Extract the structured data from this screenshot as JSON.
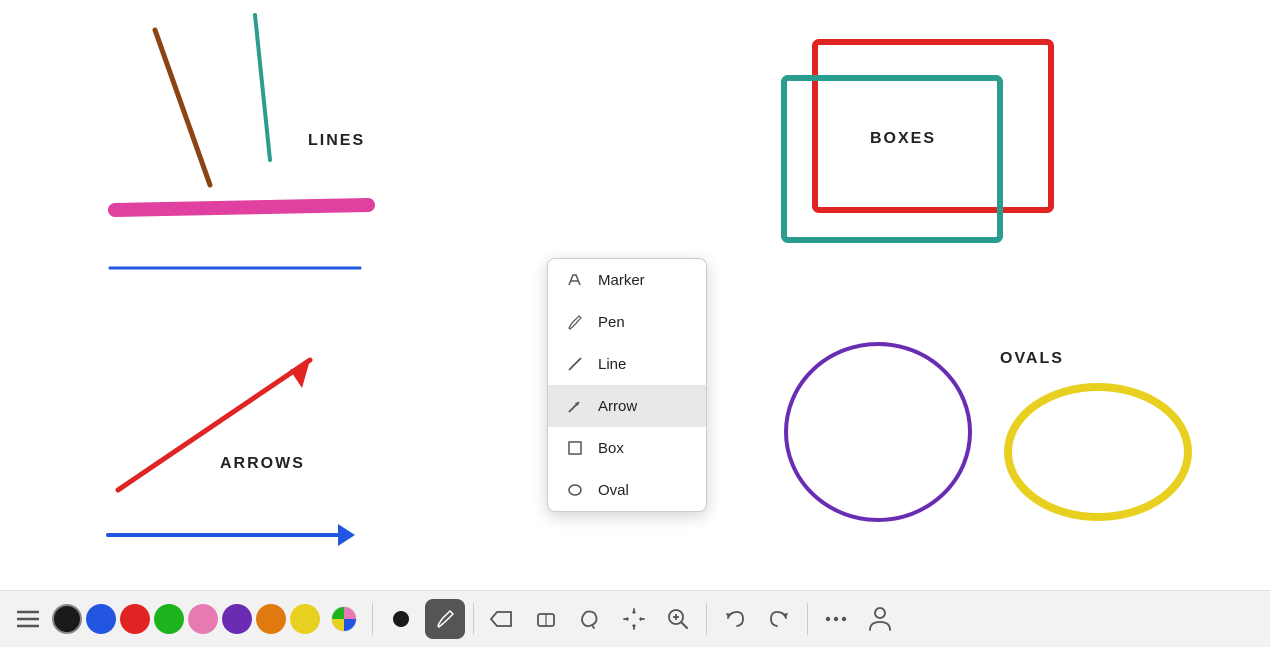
{
  "canvas": {
    "background": "#ffffff"
  },
  "labels": {
    "lines": "LINES",
    "arrows": "ARROWS",
    "boxes": "BOXES",
    "ovals": "OVALS"
  },
  "menu": {
    "items": [
      {
        "id": "marker",
        "label": "Marker",
        "icon": "marker"
      },
      {
        "id": "pen",
        "label": "Pen",
        "icon": "pen"
      },
      {
        "id": "line",
        "label": "Line",
        "icon": "line"
      },
      {
        "id": "arrow",
        "label": "Arrow",
        "icon": "arrow",
        "selected": true
      },
      {
        "id": "box",
        "label": "Box",
        "icon": "box"
      },
      {
        "id": "oval",
        "label": "Oval",
        "icon": "oval"
      }
    ]
  },
  "toolbar": {
    "colors": [
      {
        "id": "black",
        "hex": "#1a1a1a",
        "active": true
      },
      {
        "id": "blue",
        "hex": "#2356e0"
      },
      {
        "id": "red",
        "hex": "#e02323"
      },
      {
        "id": "green",
        "hex": "#1db31d"
      },
      {
        "id": "pink",
        "hex": "#e87ab3"
      },
      {
        "id": "purple",
        "hex": "#6a2cb3"
      },
      {
        "id": "orange",
        "hex": "#e07a10"
      },
      {
        "id": "yellow",
        "hex": "#e8d020"
      },
      {
        "id": "multi",
        "hex": "multi"
      }
    ],
    "tools": [
      {
        "id": "dot",
        "label": "Dot"
      },
      {
        "id": "pen-active",
        "label": "Pen Active",
        "active": true
      },
      {
        "id": "label-tool",
        "label": "Label"
      },
      {
        "id": "eraser",
        "label": "Eraser"
      },
      {
        "id": "lasso",
        "label": "Lasso"
      },
      {
        "id": "move",
        "label": "Move"
      },
      {
        "id": "zoom",
        "label": "Zoom"
      },
      {
        "id": "undo",
        "label": "Undo"
      },
      {
        "id": "redo",
        "label": "Redo"
      },
      {
        "id": "more",
        "label": "More"
      },
      {
        "id": "person",
        "label": "Person"
      }
    ]
  }
}
